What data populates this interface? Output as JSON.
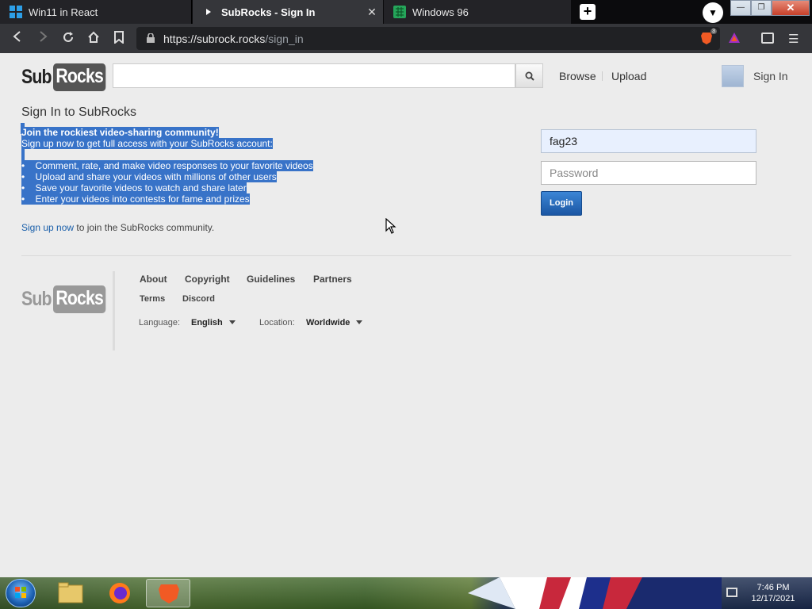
{
  "browser": {
    "tabs": [
      {
        "title": "Win11 in React",
        "active": false
      },
      {
        "title": "SubRocks - Sign In",
        "active": true
      },
      {
        "title": "Windows 96",
        "active": false
      }
    ],
    "url_host": "https://subrock.rocks",
    "url_path": "/sign_in",
    "brave_badge": "3"
  },
  "site": {
    "logo_sub": "Sub",
    "logo_rocks": "Rocks",
    "search_placeholder": "",
    "nav": {
      "browse": "Browse",
      "upload": "Upload",
      "sign_in": "Sign In"
    }
  },
  "signin": {
    "title": "Sign In to SubRocks",
    "promo_heading": "Join the rockiest video-sharing community!",
    "promo_sub": "Sign up now to get full access with your SubRocks account:",
    "benefits": [
      "Comment, rate, and make video responses to your favorite videos",
      "Upload and share your videos with millions of other users",
      "Save your favorite videos to watch and share later",
      "Enter your videos into contests for fame and prizes"
    ],
    "bullet": "•",
    "signup_link": "Sign up now",
    "signup_rest": " to join the SubRocks community.",
    "username_value": "fag23",
    "password_placeholder": "Password",
    "login_label": "Login"
  },
  "footer": {
    "links_primary": [
      "About",
      "Copyright",
      "Guidelines",
      "Partners"
    ],
    "links_secondary": [
      "Terms",
      "Discord"
    ],
    "language_label": "Language:",
    "language_value": "English",
    "location_label": "Location:",
    "location_value": "Worldwide"
  },
  "taskbar": {
    "time": "7:46 PM",
    "date": "12/17/2021"
  },
  "colors": {
    "selection": "#3873c8",
    "login_button": "#1b56a3",
    "link": "#1a5faa"
  }
}
